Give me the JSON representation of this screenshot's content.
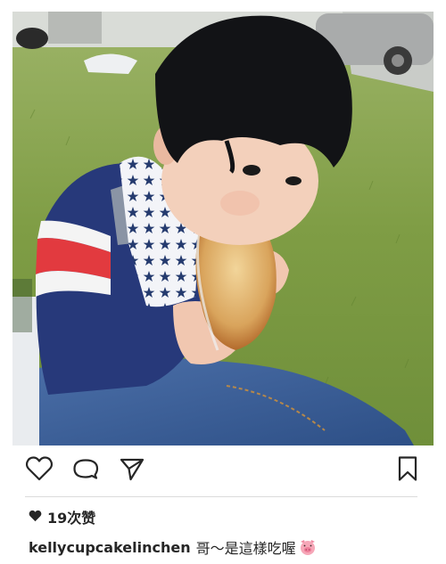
{
  "post": {
    "image_icon": "photo-toddler-eating-bread",
    "actions": {
      "like_icon": "heart-outline-icon",
      "comment_icon": "comment-bubble-icon",
      "share_icon": "send-paper-plane-icon",
      "save_icon": "bookmark-outline-icon"
    },
    "likes": {
      "icon": "heart-filled-icon",
      "text": "19次赞"
    },
    "caption": {
      "username": "kellycupcakelinchen",
      "text": "哥～是這樣吃喔",
      "emoji_icon": "pig-face-emoji"
    }
  },
  "colors": {
    "text": "#262626",
    "divider": "#dbdbdb",
    "emoji_pink": "#f6a7b8"
  }
}
